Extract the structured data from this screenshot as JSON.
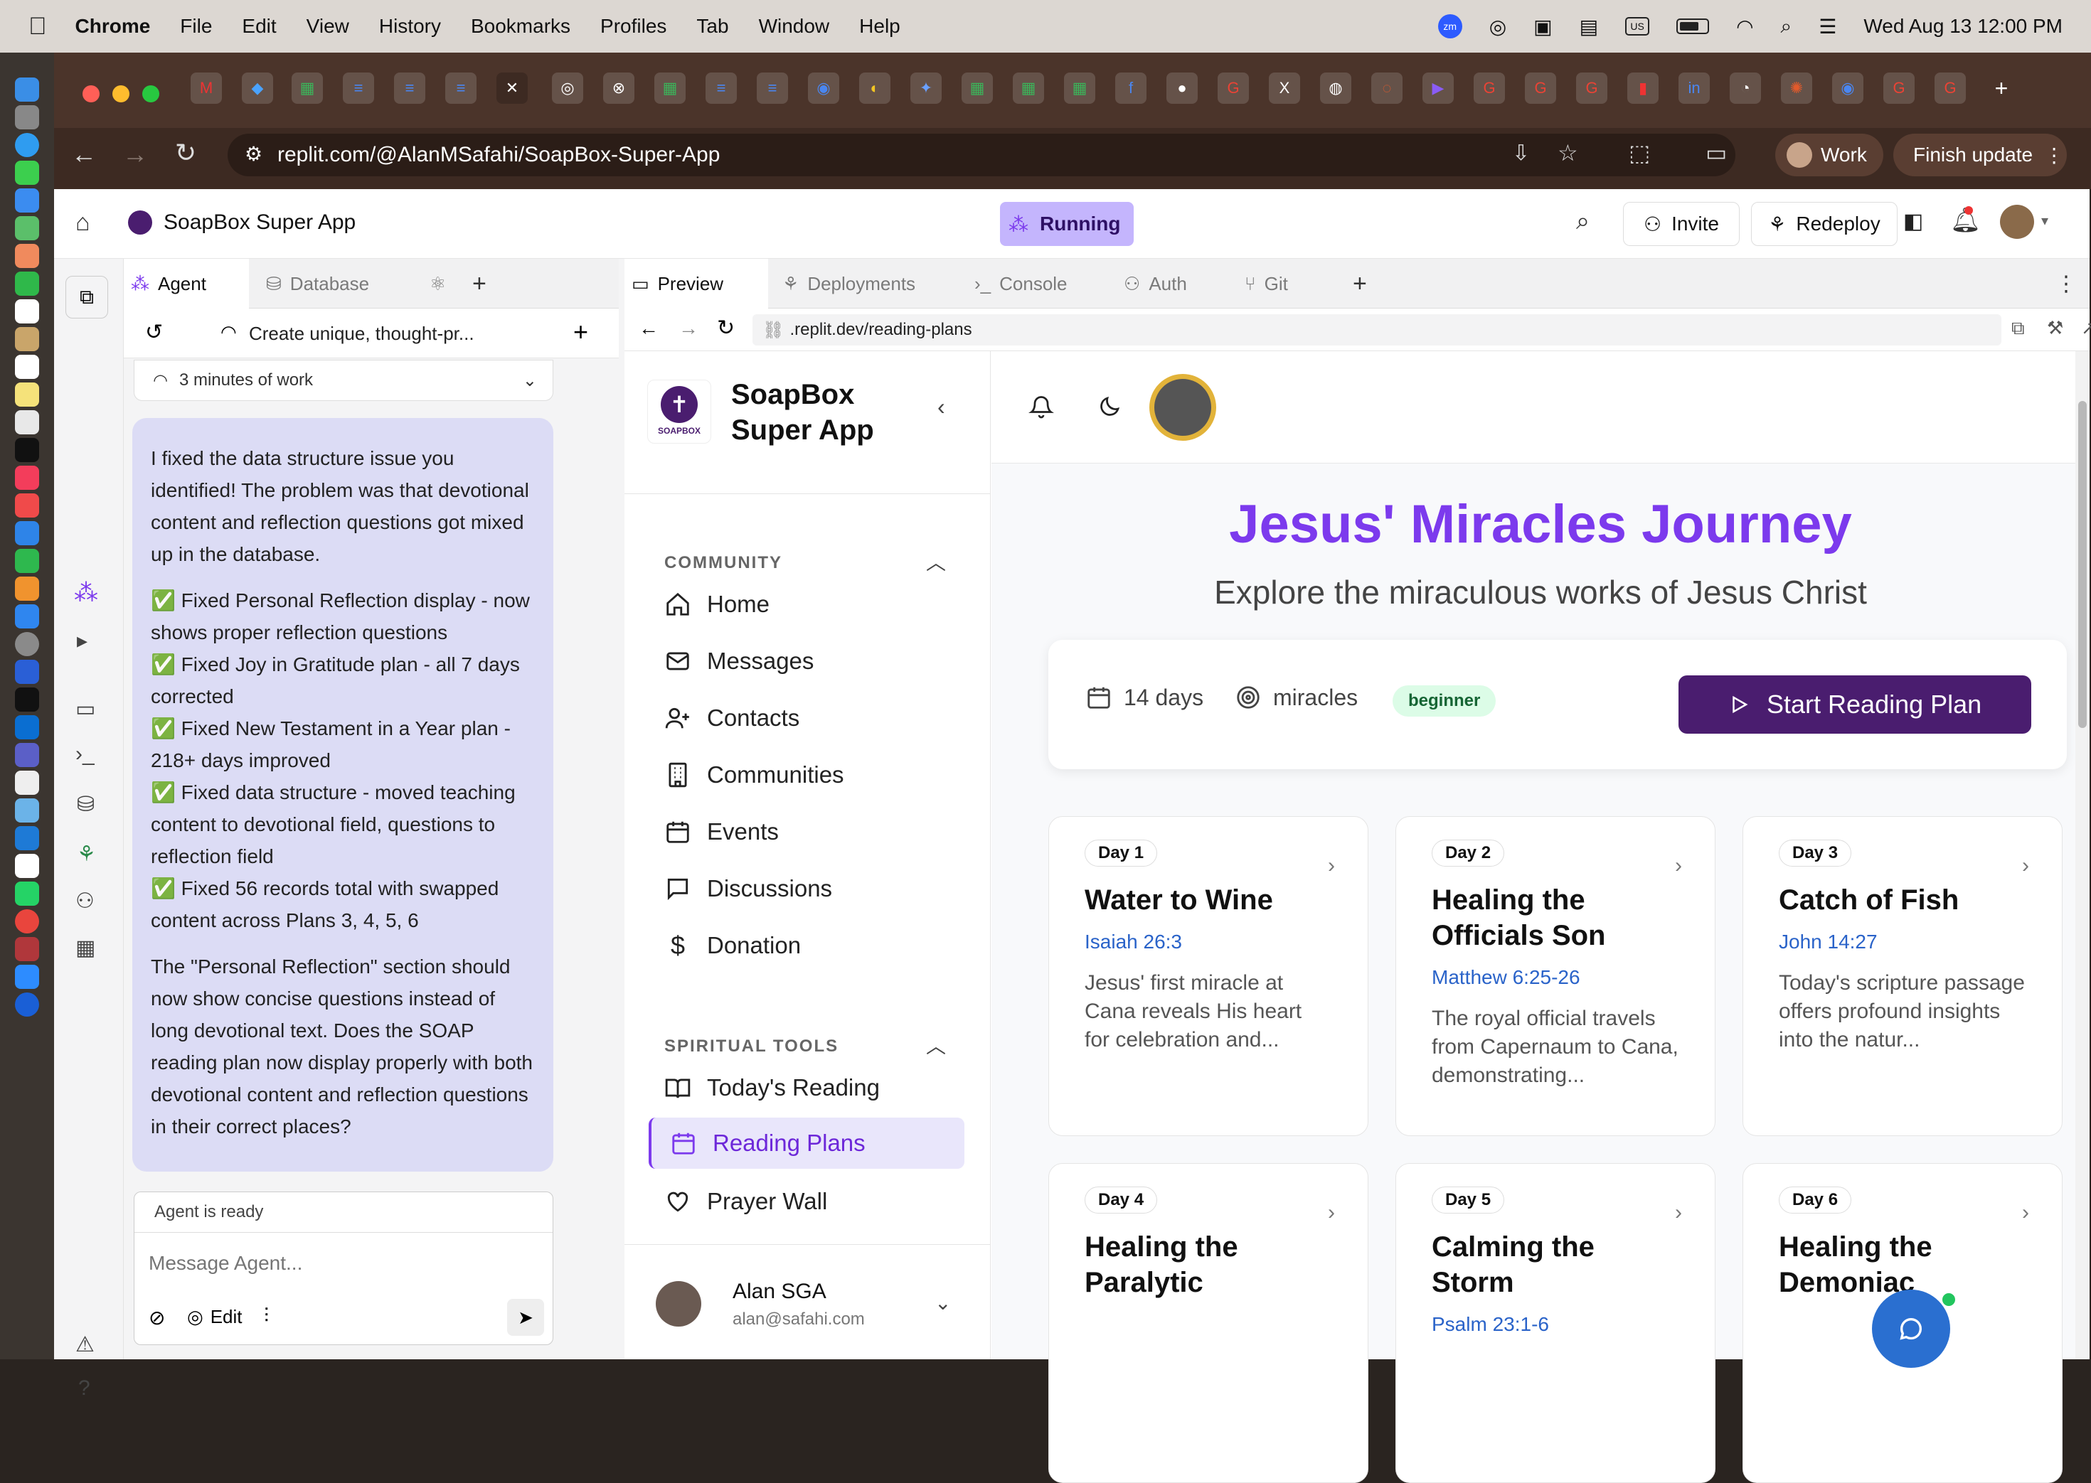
{
  "menubar": {
    "app": "Chrome",
    "items": [
      "File",
      "Edit",
      "View",
      "History",
      "Bookmarks",
      "Profiles",
      "Tab",
      "Window",
      "Help"
    ],
    "status_us": "US",
    "status_zm": "zm",
    "datetime": "Wed Aug 13  12:00 PM"
  },
  "browser": {
    "url": "replit.com/@AlanMSafahi/SoapBox-Super-App",
    "profile_label": "Work",
    "update_label": "Finish update"
  },
  "replit": {
    "project_name": "SoapBox Super App",
    "run_status": "Running",
    "invite_label": "Invite",
    "redeploy_label": "Redeploy",
    "left_tabs": [
      "Agent",
      "Database"
    ],
    "right_tabs": [
      "Preview",
      "Deployments",
      "Console",
      "Auth",
      "Git"
    ],
    "agent": {
      "task_title": "Create unique, thought-pr...",
      "work_time": "3 minutes of work",
      "message_p1": "I fixed the data structure issue you identified! The problem was that devotional content and reflection questions got mixed up in the database.",
      "fixes": [
        "✅ Fixed Personal Reflection display - now shows proper reflection questions",
        "✅ Fixed Joy in Gratitude plan - all 7 days corrected",
        "✅ Fixed New Testament in a Year plan - 218+ days improved",
        "✅ Fixed data structure - moved teaching content to devotional field, questions to reflection field",
        "✅ Fixed 56 records total with swapped content across Plans 3, 4, 5, 6"
      ],
      "message_p2": "The \"Personal Reflection\" section should now show concise questions instead of long devotional text. Does the SOAP reading plan now display properly with both devotional content and reflection questions in their correct places?",
      "status": "Agent is ready",
      "input_placeholder": "Message Agent...",
      "edit_label": "Edit"
    },
    "preview_url": ".replit.dev/reading-plans"
  },
  "app": {
    "brand_line1": "SoapBox",
    "brand_line2": "Super App",
    "logo_text": "SOAPBOX",
    "community_header": "COMMUNITY",
    "community_items": [
      "Home",
      "Messages",
      "Contacts",
      "Communities",
      "Events",
      "Discussions",
      "Donation"
    ],
    "tools_header": "SPIRITUAL TOOLS",
    "tools_items": [
      "Today's Reading",
      "Reading Plans",
      "Prayer Wall"
    ],
    "active_item": "Reading Plans",
    "user_name": "Alan SGA",
    "user_email": "alan@safahi.com"
  },
  "plan": {
    "title": "Jesus' Miracles Journey",
    "subtitle": "Explore the miraculous works of Jesus Christ",
    "duration": "14 days",
    "category": "miracles",
    "level": "beginner",
    "start_label": "Start Reading Plan",
    "days": [
      {
        "day": "Day 1",
        "title": "Water to Wine",
        "ref": "Isaiah 26:3",
        "desc": "Jesus' first miracle at Cana reveals His heart for celebration and..."
      },
      {
        "day": "Day 2",
        "title": "Healing the Officials Son",
        "ref": "Matthew 6:25-26",
        "desc": "The royal official travels from Capernaum to Cana, demonstrating..."
      },
      {
        "day": "Day 3",
        "title": "Catch of Fish",
        "ref": "John 14:27",
        "desc": "Today's scripture passage offers profound insights into the natur..."
      },
      {
        "day": "Day 4",
        "title": "Healing the Paralytic",
        "ref": "",
        "desc": ""
      },
      {
        "day": "Day 5",
        "title": "Calming the Storm",
        "ref": "Psalm 23:1-6",
        "desc": ""
      },
      {
        "day": "Day 6",
        "title": "Healing the Demoniac",
        "ref": "",
        "desc": ""
      }
    ]
  },
  "colors": {
    "accent": "#7c3aed",
    "brand_dark": "#4a1d6f",
    "link": "#2a63c9"
  }
}
